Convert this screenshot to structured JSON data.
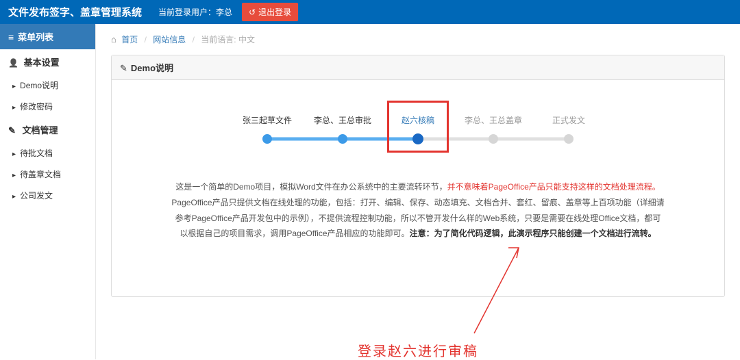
{
  "header": {
    "title": "文件发布签字、盖章管理系统",
    "user_prefix": "当前登录用户：",
    "user_name": "李总",
    "logout": "退出登录"
  },
  "sidebar": {
    "menu_title": "菜单列表",
    "sections": [
      {
        "title": "基本设置",
        "items": [
          "Demo说明",
          "修改密码"
        ]
      },
      {
        "title": "文档管理",
        "items": [
          "待批文档",
          "待盖章文档",
          "公司发文"
        ]
      }
    ]
  },
  "breadcrumb": {
    "home": "首页",
    "page": "网站信息",
    "lang_label": "当前语言:",
    "lang_value": "中文"
  },
  "panel": {
    "title": "Demo说明"
  },
  "stepper": {
    "steps": [
      {
        "label": "张三起草文件",
        "state": "done"
      },
      {
        "label": "李总、王总审批",
        "state": "done"
      },
      {
        "label": "赵六核稿",
        "state": "highlight"
      },
      {
        "label": "李总、王总盖章",
        "state": "future"
      },
      {
        "label": "正式发文",
        "state": "future"
      }
    ]
  },
  "desc": {
    "t1": "这是一个简单的Demo项目，模拟Word文件在办公系统中的主要流转环节，",
    "t1_red": "并不意味着PageOffice产品只能支持这样的文档处理流程。",
    "t2a": "PageOffice产品只提供文档在线处理的功能，包括：打开、编辑、保存、动态填充、文档合并、套红、留痕、盖章等上百项功能（详细请参考PageOffice产品开发包中的示例），不提供流程控制功能，",
    "t2b": "所以不管开发什么样的Web系统，只要是需要在线处理Office文档，都可以根据自己的项目需求，调用PageOffice产品相应的功能即可。",
    "t2_bold": "注意：为了简化代码逻辑，此演示程序只能创建一个文档进行流转。"
  },
  "annotation": {
    "text": "登录赵六进行审稿"
  }
}
